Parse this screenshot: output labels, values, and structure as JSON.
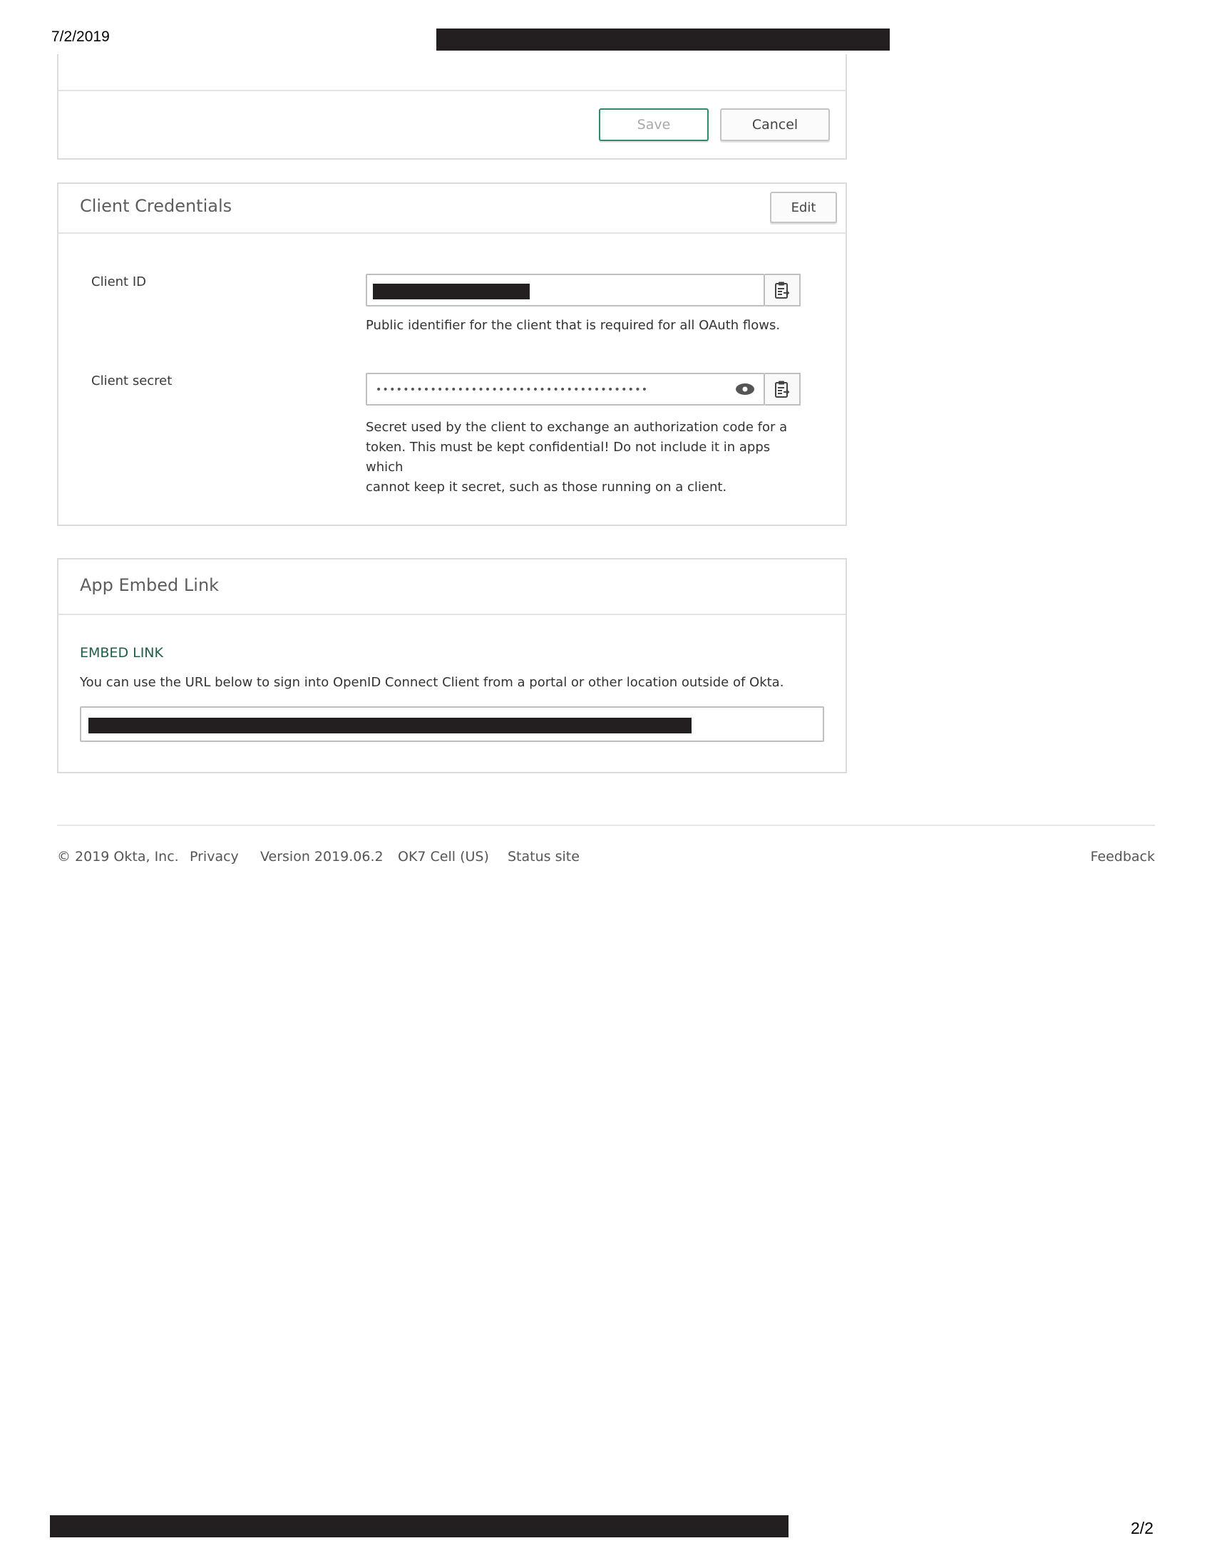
{
  "print_header": {
    "date": "7/2/2019"
  },
  "print_footer": {
    "page": "2/2"
  },
  "top_panel": {
    "save_label": "Save",
    "cancel_label": "Cancel"
  },
  "client_credentials": {
    "title": "Client Credentials",
    "edit_label": "Edit",
    "client_id": {
      "label": "Client ID",
      "help": "Public identifier for the client that is required for all OAuth flows."
    },
    "client_secret": {
      "label": "Client secret",
      "masked_value": "••••••••••••••••••••••••••••••••••••••••",
      "help_lines": [
        "Secret used by the client to exchange an authorization code for a",
        "token. This must be kept confidential! Do not include it in apps which",
        "cannot keep it secret, such as those running on a client."
      ]
    }
  },
  "embed": {
    "title": "App Embed Link",
    "section_label": "EMBED LINK",
    "description": "You can use the URL below to sign into OpenID Connect Client from a portal or other location outside of Okta."
  },
  "footer": {
    "copyright": "© 2019 Okta, Inc.",
    "privacy": "Privacy",
    "version": "Version 2019.06.2",
    "cell": "OK7 Cell (US)",
    "status": "Status site",
    "feedback": "Feedback"
  },
  "colors": {
    "accent": "#2e8b6e",
    "embed_label": "#1f5e4a",
    "redaction": "#231f20"
  },
  "icons": {
    "copy": "clipboard-icon",
    "reveal": "eye-icon"
  }
}
